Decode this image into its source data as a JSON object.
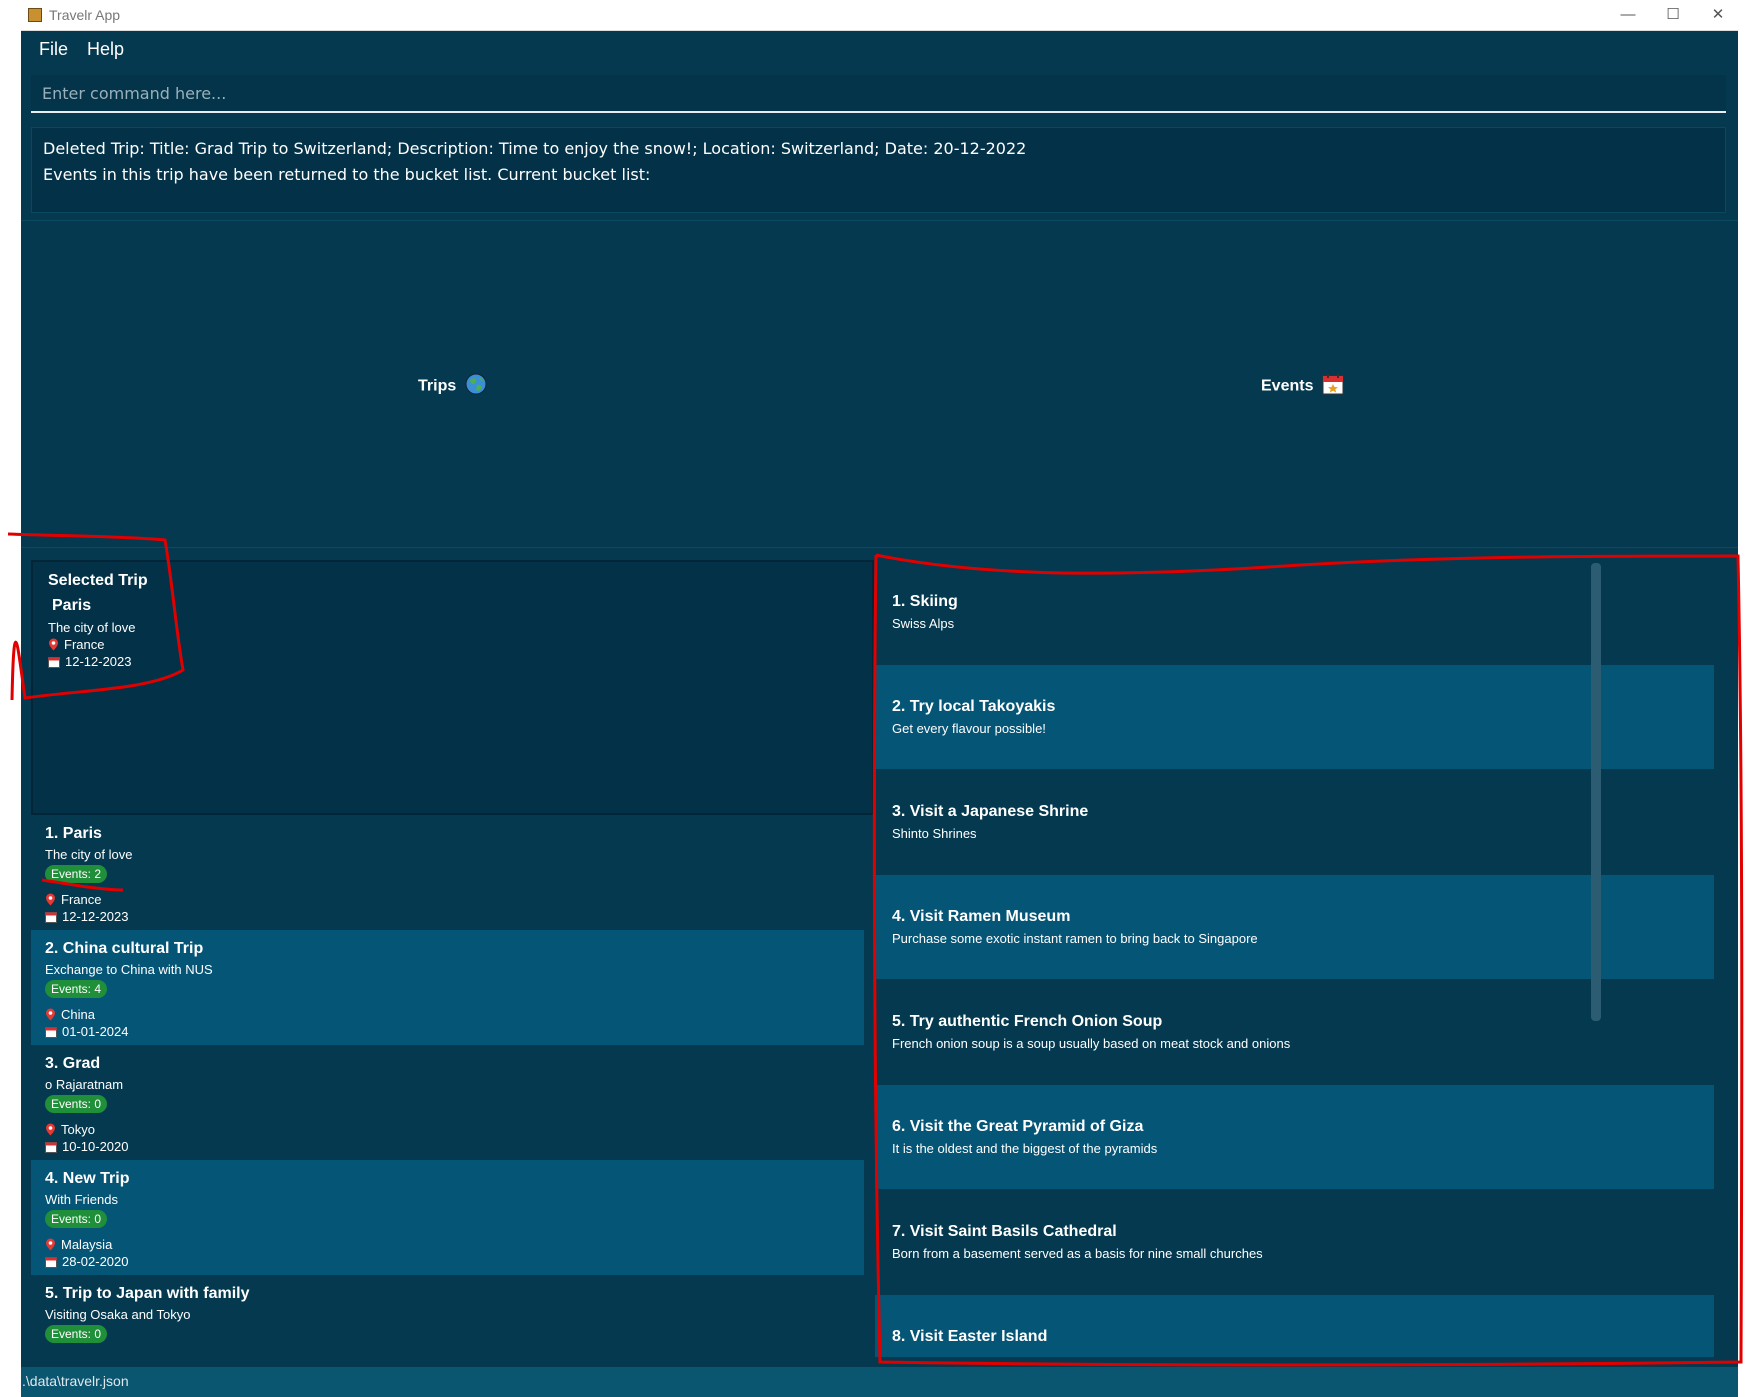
{
  "window": {
    "title": "Travelr App",
    "minimize": "—",
    "maximize": "☐",
    "close": "✕"
  },
  "menu": {
    "file": "File",
    "help": "Help"
  },
  "command": {
    "placeholder": "Enter command here..."
  },
  "result": {
    "line1": "Deleted Trip: Title: Grad Trip to Switzerland; Description: Time to enjoy the snow!; Location: Switzerland; Date: 20-12-2022",
    "line2": "Events in this trip have been returned to the bucket list. Current bucket list:"
  },
  "headers": {
    "trips": "Trips",
    "events": "Events"
  },
  "selected_trip": {
    "label": "Selected Trip",
    "title": "Paris",
    "description": "The city of love",
    "location": "France",
    "date": "12-12-2023"
  },
  "trips": [
    {
      "title": "1.  Paris",
      "description": "The city of love",
      "events": "Events: 2",
      "location": "France",
      "date": "12-12-2023"
    },
    {
      "title": "2.  China cultural Trip",
      "description": "Exchange to China with NUS",
      "events": "Events: 4",
      "location": "China",
      "date": "01-01-2024"
    },
    {
      "title": "3.  Grad",
      "description": "o Rajaratnam",
      "events": "Events: 0",
      "location": "Tokyo",
      "date": "10-10-2020"
    },
    {
      "title": "4.  New Trip",
      "description": "With Friends",
      "events": "Events: 0",
      "location": "Malaysia",
      "date": "28-02-2020"
    },
    {
      "title": "5.  Trip to Japan with family",
      "description": "Visiting Osaka and Tokyo",
      "events": "Events: 0",
      "location": "",
      "date": ""
    }
  ],
  "events": [
    {
      "title": "1.  Skiing",
      "description": "Swiss Alps"
    },
    {
      "title": "2.  Try local Takoyakis",
      "description": "Get every flavour possible!"
    },
    {
      "title": "3.  Visit a Japanese Shrine",
      "description": "Shinto Shrines"
    },
    {
      "title": "4.  Visit Ramen Museum",
      "description": "Purchase some exotic instant ramen to bring back to Singapore"
    },
    {
      "title": "5.  Try authentic French Onion Soup",
      "description": "French onion soup is a soup usually based on meat stock and onions"
    },
    {
      "title": "6.  Visit the Great Pyramid of Giza",
      "description": "It is the oldest and the biggest of the pyramids"
    },
    {
      "title": "7.  Visit Saint Basils Cathedral",
      "description": "Born from a basement served as a basis for nine small churches"
    },
    {
      "title": "8.  Visit Easter Island",
      "description": ""
    }
  ],
  "status": {
    "path": ".\\data\\travelr.json"
  },
  "colors": {
    "background": "#04394f",
    "row_alt": "#055576",
    "badge": "#1f8f3a",
    "annotation": "#e00000"
  },
  "icons": {
    "trips": "globe-icon",
    "events": "calendar-icon",
    "location": "pin-icon",
    "date": "calendar-icon"
  }
}
